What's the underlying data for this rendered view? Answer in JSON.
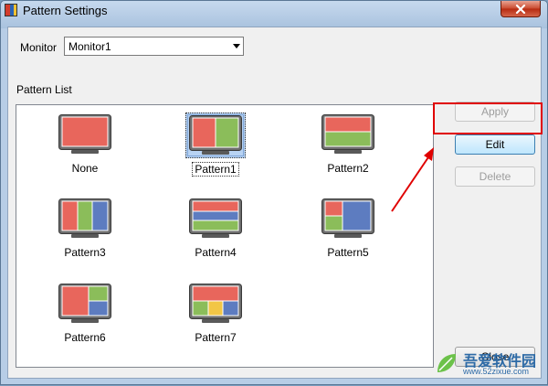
{
  "window": {
    "title": "Pattern Settings"
  },
  "monitor": {
    "label": "Monitor",
    "selected": "Monitor1"
  },
  "pattern_list": {
    "label": "Pattern List",
    "items": [
      {
        "name": "None",
        "layout": "none"
      },
      {
        "name": "Pattern1",
        "layout": "2col",
        "selected": true
      },
      {
        "name": "Pattern2",
        "layout": "2row"
      },
      {
        "name": "Pattern3",
        "layout": "3col"
      },
      {
        "name": "Pattern4",
        "layout": "3row"
      },
      {
        "name": "Pattern5",
        "layout": "quad-left"
      },
      {
        "name": "Pattern6",
        "layout": "left-plus-2"
      },
      {
        "name": "Pattern7",
        "layout": "top-plus-3"
      }
    ]
  },
  "buttons": {
    "apply": "Apply",
    "edit": "Edit",
    "delete": "Delete",
    "close": "Close"
  },
  "watermark": {
    "site": "吾爱软件园",
    "url": "www.52zixue.com"
  },
  "colors": {
    "red": "#e8665c",
    "green": "#8bbd5a",
    "blue": "#5d7cc0",
    "yellow": "#f2c646",
    "highlight": "#e00000"
  }
}
